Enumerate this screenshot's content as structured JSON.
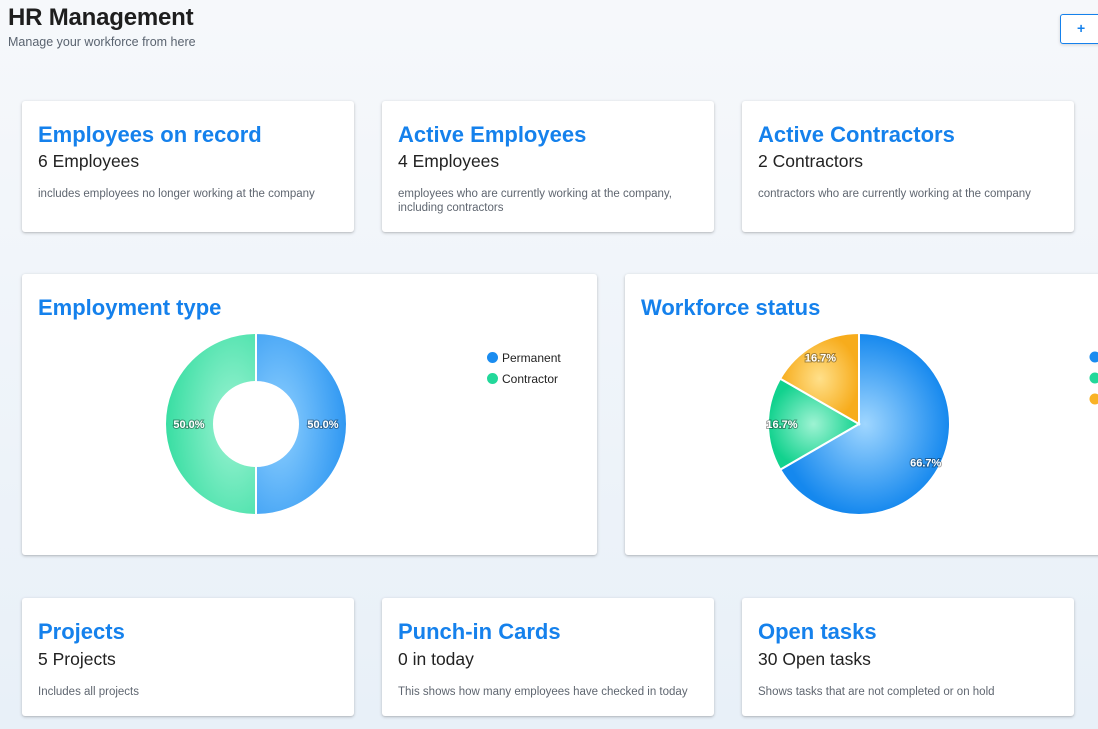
{
  "header": {
    "title": "HR Management",
    "subtitle": "Manage your workforce from here",
    "add_label": "+"
  },
  "stats_top": [
    {
      "title": "Employees on record",
      "value": "6 Employees",
      "description": "includes employees no longer working at the company"
    },
    {
      "title": "Active Employees",
      "value": "4 Employees",
      "description": "employees who are currently working at the company, including contractors"
    },
    {
      "title": "Active Contractors",
      "value": "2 Contractors",
      "description": "contractors who are currently working at the company"
    }
  ],
  "stats_bottom": [
    {
      "title": "Projects",
      "value": "5 Projects",
      "description": "Includes all projects"
    },
    {
      "title": "Punch-in Cards",
      "value": "0 in today",
      "description": "This shows how many employees have checked in today"
    },
    {
      "title": "Open tasks",
      "value": "30 Open tasks",
      "description": "Shows tasks that are not completed or on hold"
    }
  ],
  "colors": {
    "accent": "#1581ec",
    "blue": "#1a8cf0",
    "green": "#22d89a",
    "orange": "#f9b225"
  },
  "chart_data": [
    {
      "type": "pie",
      "variant": "donut",
      "title": "Employment type",
      "legend": [
        "Permanent",
        "Contractor"
      ],
      "legend_position": "top-right",
      "values": [
        50.0,
        50.0
      ],
      "labels": [
        "50.0%",
        "50.0%"
      ],
      "colors": [
        "#1a8cf0",
        "#22d89a"
      ]
    },
    {
      "type": "pie",
      "title": "Workforce status",
      "legend_position": "right",
      "values": [
        66.7,
        16.7,
        16.7
      ],
      "labels": [
        "66.7%",
        "16.7%",
        "16.7%"
      ],
      "colors": [
        "#1a8cf0",
        "#22d89a",
        "#f9b225"
      ]
    }
  ]
}
